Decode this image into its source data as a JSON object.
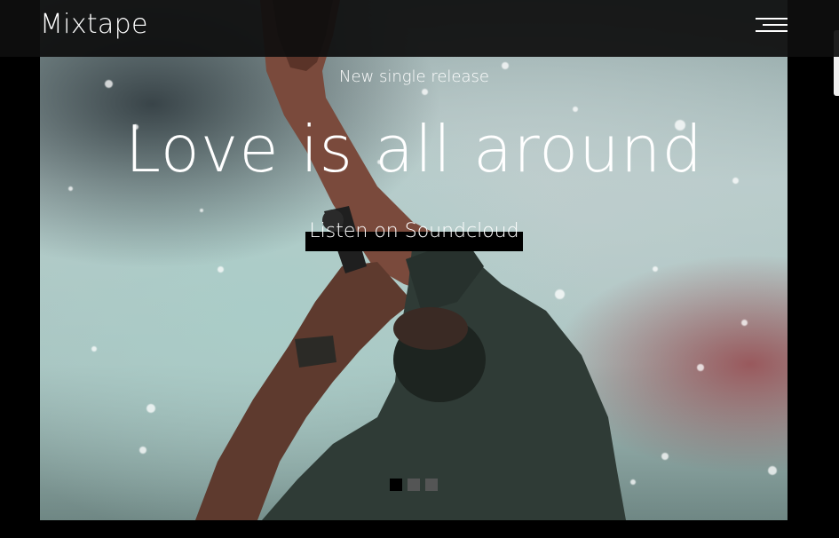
{
  "header": {
    "brand": "Mixtape",
    "menu_icon": "hamburger-menu-icon"
  },
  "hero": {
    "subtitle": "New single release",
    "headline": "Love is all around",
    "cta_label": "Listen on Soundcloud",
    "background": "concert-performer-photo"
  },
  "slider": {
    "slides": 3,
    "active_index": 0,
    "active_color": "#000000",
    "inactive_color": "#5a5a5a"
  },
  "colors": {
    "header_bg": "#0e0e0e",
    "text": "#ffffff",
    "cta_bg": "#000000"
  }
}
